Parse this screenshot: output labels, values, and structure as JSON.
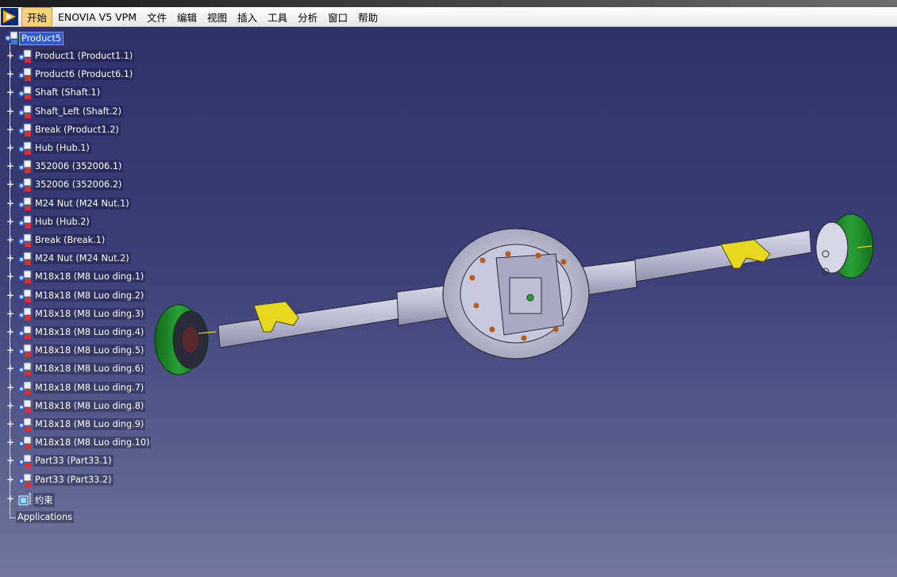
{
  "app": {
    "menu": [
      "开始",
      "ENOVIA V5 VPM",
      "文件",
      "编辑",
      "视图",
      "插入",
      "工具",
      "分析",
      "窗口",
      "帮助"
    ]
  },
  "tree": {
    "root": "Product5",
    "items": [
      "Product1 (Product1.1)",
      "Product6 (Product6.1)",
      "Shaft (Shaft.1)",
      "Shaft_Left (Shaft.2)",
      "Break (Product1.2)",
      "Hub (Hub.1)",
      "352006 (352006.1)",
      "352006 (352006.2)",
      "M24 Nut (M24 Nut.1)",
      "Hub (Hub.2)",
      "Break (Break.1)",
      "M24 Nut (M24 Nut.2)",
      "M18x18 (M8 Luo ding.1)",
      "M18x18 (M8 Luo ding.2)",
      "M18x18 (M8 Luo ding.3)",
      "M18x18 (M8 Luo ding.4)",
      "M18x18 (M8 Luo ding.5)",
      "M18x18 (M8 Luo ding.6)",
      "M18x18 (M8 Luo ding.7)",
      "M18x18 (M8 Luo ding.8)",
      "M18x18 (M8 Luo ding.9)",
      "M18x18 (M8 Luo ding.10)",
      "Part33 (Part33.1)",
      "Part33 (Part33.2)"
    ],
    "constraints": "约束",
    "applications": "Applications"
  },
  "colors": {
    "background_top": "#2d2f6b",
    "background_bottom": "#75779c",
    "selection": "#2c5bd6",
    "hub_green": "#1f8a2a",
    "bracket_yellow": "#e8d81e",
    "axle_gray": "#bdbdd2"
  },
  "icons": {
    "app_logo": "catia-logo-icon",
    "product": "product-icon",
    "part": "part-icon",
    "constraints": "constraints-icon"
  }
}
